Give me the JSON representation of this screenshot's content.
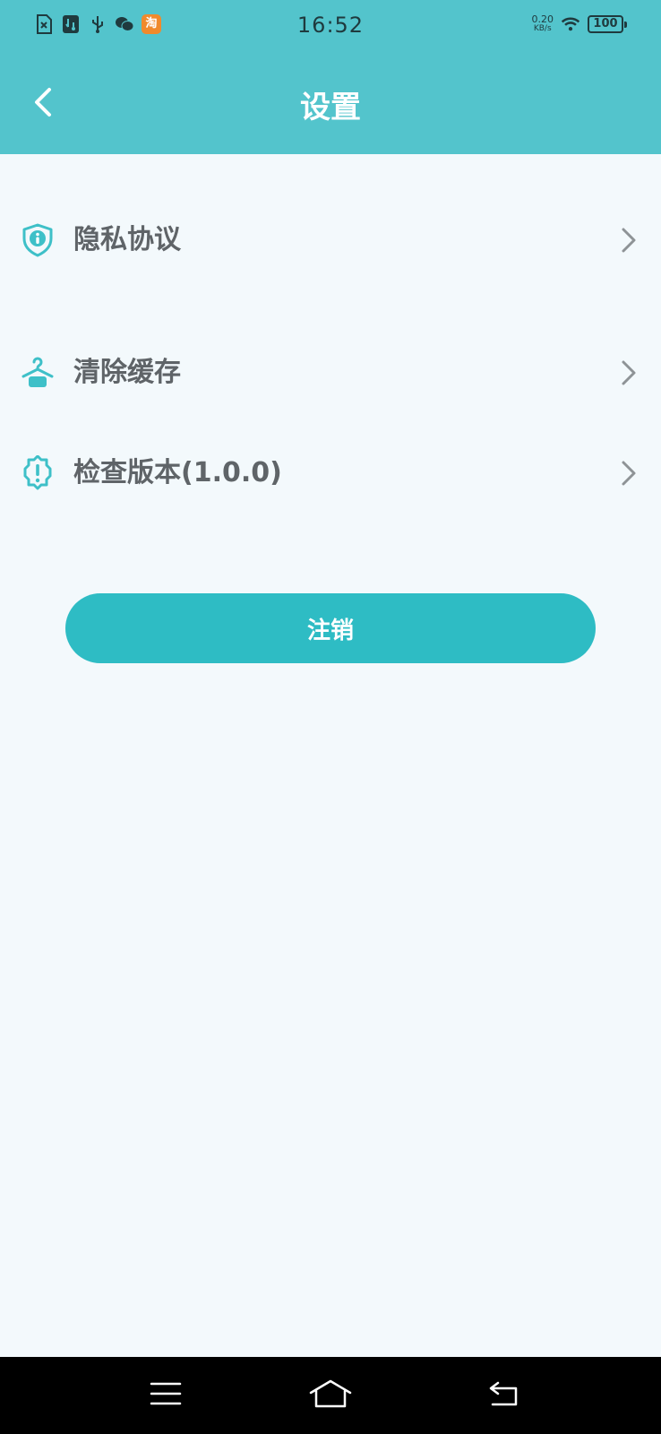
{
  "status_bar": {
    "time": "16:52",
    "net_speed_value": "0.20",
    "net_speed_unit": "KB/s",
    "battery": "100",
    "taobao_glyph": "淘",
    "left_icons": [
      "sim-error-icon",
      "usb-debug-icon",
      "usb-icon",
      "wechat-icon",
      "taobao-icon"
    ]
  },
  "header": {
    "title": "设置",
    "back_icon": "chevron-left-icon"
  },
  "settings": {
    "items": [
      {
        "label": "隐私协议",
        "icon": "shield-info-icon"
      },
      {
        "label": "清除缓存",
        "icon": "hanger-icon"
      },
      {
        "label": "检查版本(1.0.0)",
        "icon": "badge-alert-icon"
      }
    ]
  },
  "logout": {
    "label": "注销"
  },
  "nav_bar": {
    "icons": [
      "menu-icon",
      "home-icon",
      "back-icon"
    ]
  },
  "colors": {
    "header": "#53c4cc",
    "accent": "#2ebcc4",
    "background": "#f3f9fc",
    "text": "#5f6468"
  }
}
